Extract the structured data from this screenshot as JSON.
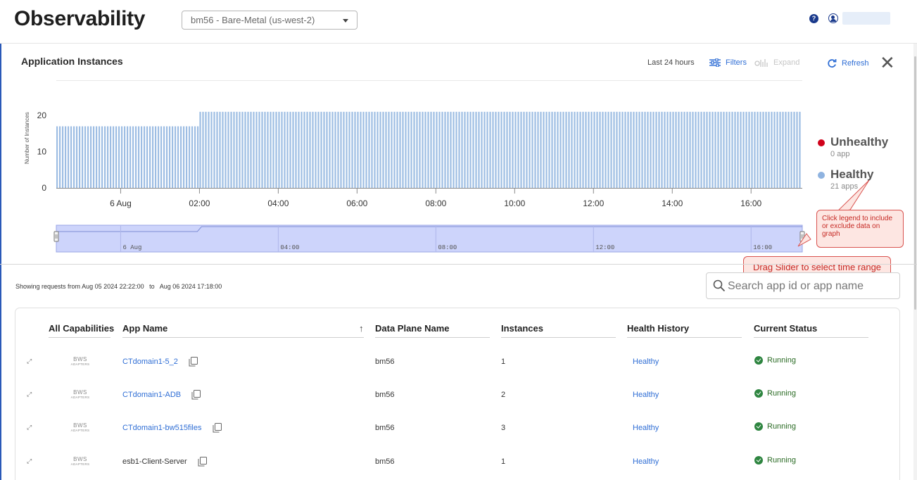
{
  "header": {
    "title": "Observability",
    "environment": "bm56 - Bare-Metal (us-west-2)"
  },
  "panel": {
    "title": "Application Instances",
    "time_range": "Last 24 hours",
    "filters_label": "Filters",
    "expand_label": "Expand",
    "refresh_label": "Refresh"
  },
  "chart_data": {
    "type": "bar",
    "ylabel": "Number of Instances",
    "yticks": [
      0,
      10,
      20
    ],
    "ylim": [
      0,
      22
    ],
    "x_tick_labels": [
      "6 Aug",
      "02:00",
      "04:00",
      "06:00",
      "08:00",
      "10:00",
      "12:00",
      "14:00",
      "16:00"
    ],
    "x_range": [
      "2024-08-05 22:22",
      "2024-08-06 17:18"
    ],
    "series": [
      {
        "name": "Healthy",
        "color": "#9dbde3",
        "segments": [
          {
            "from": "2024-08-05 22:22",
            "to": "2024-08-06 02:00",
            "value": 17
          },
          {
            "from": "2024-08-06 02:00",
            "to": "2024-08-06 17:18",
            "value": 21
          }
        ]
      },
      {
        "name": "Unhealthy",
        "color": "#d0021b",
        "segments": []
      }
    ],
    "navigator_labels": [
      "6 Aug",
      "04:00",
      "08:00",
      "12:00",
      "16:00"
    ],
    "grid": false
  },
  "legend": [
    {
      "name": "Unhealthy",
      "sub": "0 app",
      "color": "#d0021b"
    },
    {
      "name": "Healthy",
      "sub": "21 apps",
      "color": "#8fb3e0"
    }
  ],
  "callouts": {
    "legend_tip": "Click legend to include or exclude data on graph",
    "slider_tip": "Drag Slider to select time range"
  },
  "showing": {
    "prefix": "Showing requests from",
    "from": "Aug 05 2024 22:22:00",
    "to_word": "to",
    "to": "Aug 06 2024 17:18:00"
  },
  "search": {
    "placeholder": "Search app id or app name"
  },
  "table": {
    "columns": [
      "All Capabilities",
      "App Name",
      "Data Plane Name",
      "Instances",
      "Health History",
      "Current Status"
    ],
    "capability_logo": {
      "line1": "BWS",
      "line2": "ADAPTERS"
    },
    "rows": [
      {
        "app": "CTdomain1-5_2",
        "app_link": true,
        "dataplane": "bm56",
        "instances": "1",
        "health": "Healthy",
        "status": "Running"
      },
      {
        "app": "CTdomain1-ADB",
        "app_link": true,
        "dataplane": "bm56",
        "instances": "2",
        "health": "Healthy",
        "status": "Running"
      },
      {
        "app": "CTdomain1-bw515files",
        "app_link": true,
        "dataplane": "bm56",
        "instances": "3",
        "health": "Healthy",
        "status": "Running"
      },
      {
        "app": "esb1-Client-Server",
        "app_link": false,
        "dataplane": "bm56",
        "instances": "1",
        "health": "Healthy",
        "status": "Running"
      }
    ]
  }
}
